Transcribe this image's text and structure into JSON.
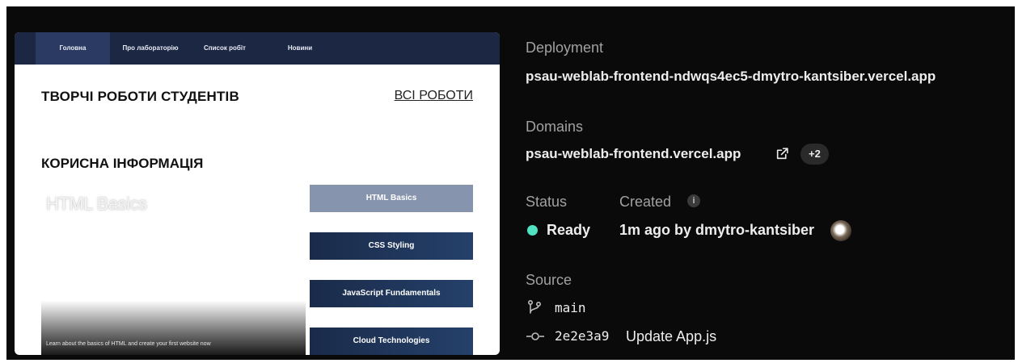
{
  "preview": {
    "nav": [
      "Головна",
      "Про лабораторію",
      "Список робіт",
      "Новини"
    ],
    "heading_works": "ТВОРЧІ РОБОТИ СТУДЕНТІВ",
    "all_works_link": "ВСІ РОБОТИ",
    "heading_info": "КОРИСНА ІНФОРМАЦІЯ",
    "hero_title": "HTML Basics",
    "hero_description": "Learn about the basics of HTML and create your first website now",
    "topics": [
      "HTML Basics",
      "CSS Styling",
      "JavaScript Fundamentals",
      "Cloud Technologies"
    ]
  },
  "deployment": {
    "label": "Deployment",
    "url": "psau-weblab-frontend-ndwqs4ec5-dmytro-kantsiber.vercel.app"
  },
  "domains": {
    "label": "Domains",
    "primary": "psau-weblab-frontend.vercel.app",
    "more_count": "+2",
    "icon": "external-link-icon"
  },
  "status": {
    "label": "Status",
    "value": "Ready",
    "color": "#50e3c2"
  },
  "created": {
    "label": "Created",
    "value": "1m ago by dmytro-kantsiber",
    "info_icon": "i"
  },
  "source": {
    "label": "Source",
    "branch": "main",
    "commit_hash": "2e2e3a9",
    "commit_message": "Update App.js"
  }
}
